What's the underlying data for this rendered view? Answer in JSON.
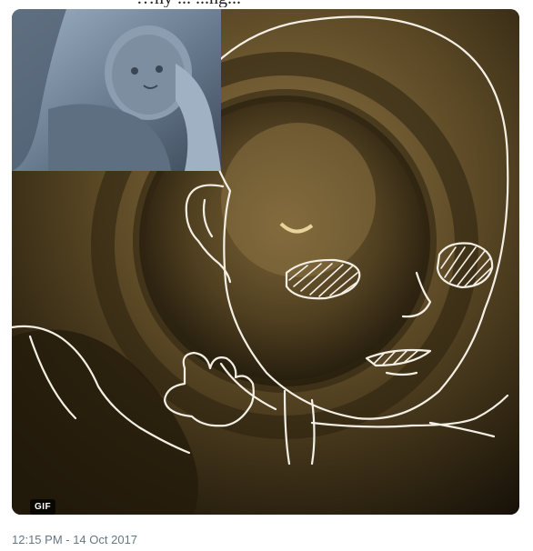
{
  "header": {
    "caption_partial": "…ny     ...                    ...ng..."
  },
  "media": {
    "badge": "GIF",
    "kind": "animated-gif",
    "inset_photo": "statue-of-baby-icon"
  },
  "meta": {
    "timestamp": "12:15 PM - 14 Oct 2017"
  },
  "colors": {
    "card_bg": "#1b150c",
    "sepia_mid": "#6e5a33",
    "line_art": "#f5f0e6",
    "timestamp": "#657786"
  }
}
